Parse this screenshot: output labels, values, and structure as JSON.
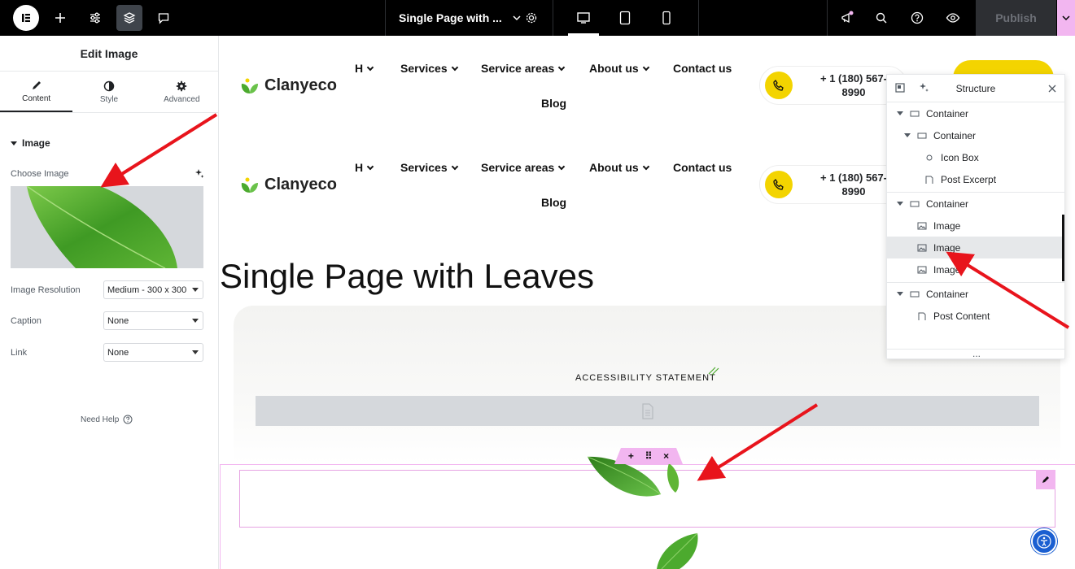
{
  "topbar": {
    "page_title": "Single Page with ...",
    "publish_label": "Publish"
  },
  "panel": {
    "title": "Edit Image",
    "tabs": [
      {
        "label": "Content"
      },
      {
        "label": "Style"
      },
      {
        "label": "Advanced"
      }
    ],
    "section_title": "Image",
    "choose_image_label": "Choose Image",
    "image_resolution_label": "Image Resolution",
    "image_resolution_value": "Medium - 300 x 300",
    "caption_label": "Caption",
    "caption_value": "None",
    "link_label": "Link",
    "link_value": "None",
    "need_help": "Need Help"
  },
  "site": {
    "brand": "Clanyeco",
    "nav": [
      "H",
      "Services",
      "Service areas",
      "About us",
      "Contact us",
      "Blog"
    ],
    "phone_line1": "+ 1 (180) 567-",
    "phone_line2": "8990",
    "page_heading": "Single Page with Leaves",
    "accessibility": "ACCESSIBILITY STATEMENT"
  },
  "handle": {
    "add": "+",
    "move": "⠿",
    "close": "×"
  },
  "structure": {
    "title": "Structure",
    "items": [
      {
        "label": "Container",
        "type": "container"
      },
      {
        "label": "Container",
        "type": "container"
      },
      {
        "label": "Icon Box",
        "type": "iconbox"
      },
      {
        "label": "Post Excerpt",
        "type": "doc"
      },
      {
        "label": "Container",
        "type": "container"
      },
      {
        "label": "Image",
        "type": "image"
      },
      {
        "label": "Image",
        "type": "image",
        "selected": true
      },
      {
        "label": "Image",
        "type": "image"
      },
      {
        "label": "Container",
        "type": "container"
      },
      {
        "label": "Post Content",
        "type": "doc"
      }
    ],
    "footer_dots": "..."
  },
  "colors": {
    "accent_pink": "#f2b6f0",
    "brand_yellow": "#f3d400",
    "arrow_red": "#e8141c",
    "leaf_green": "#4caa2e"
  }
}
